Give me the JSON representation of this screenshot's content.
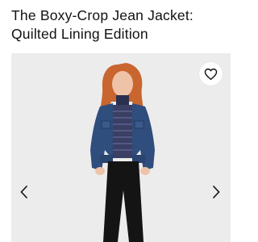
{
  "product": {
    "title": "The Boxy-Crop Jean Jacket: Quilted Lining Edition"
  },
  "gallery": {
    "image_description_icon": "model-wearing-denim-jacket-image",
    "favorite_icon": "heart-icon",
    "prev_icon": "chevron-left-icon",
    "next_icon": "chevron-right-icon"
  },
  "colors": {
    "background": "#ffffff",
    "gallery_bg": "#ececec",
    "denim": "#2f4d7d",
    "text": "#111111"
  }
}
